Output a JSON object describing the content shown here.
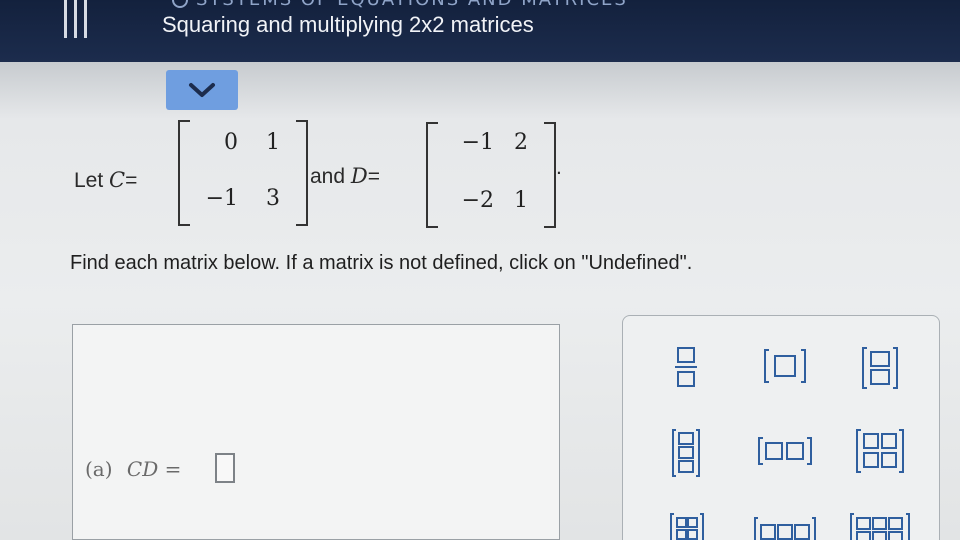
{
  "header": {
    "section_crumb": "SYSTEMS OF EQUATIONS AND MATRICES",
    "title": "Squaring and multiplying 2x2 matrices"
  },
  "problem": {
    "let_text": "Let",
    "matrix_c_name": "C",
    "equals": "=",
    "matrix_c": [
      [
        "0",
        "1"
      ],
      [
        "−1",
        "3"
      ]
    ],
    "and_text": "and",
    "matrix_d_name": "D",
    "matrix_d": [
      [
        "−1",
        "2"
      ],
      [
        "−2",
        "1"
      ]
    ],
    "period": "."
  },
  "instruction": "Find each matrix below. If a matrix is not defined, click on \"Undefined\".",
  "answer": {
    "part_label": "(a)",
    "expression": "CD ="
  },
  "tools": [
    {
      "name": "fraction-tool-icon"
    },
    {
      "name": "matrix-1x1-tool-icon"
    },
    {
      "name": "matrix-2x1-tool-icon"
    },
    {
      "name": "matrix-3x1-tool-icon"
    },
    {
      "name": "matrix-1x2-tool-icon"
    },
    {
      "name": "matrix-2x2-tool-icon"
    },
    {
      "name": "matrix-3x2-tool-icon"
    },
    {
      "name": "matrix-1x3-tool-icon"
    },
    {
      "name": "matrix-2x3-tool-icon"
    }
  ],
  "colors": {
    "header_bg": "#13213d",
    "collapse_tab": "#6f9ee0",
    "page_bg": "#ebedee"
  }
}
